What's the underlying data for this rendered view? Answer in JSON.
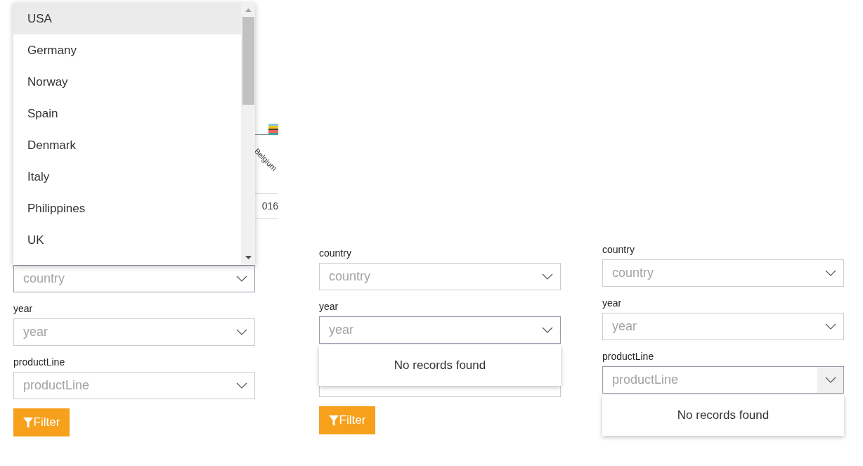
{
  "background_chart": {
    "x_label": "Belgium",
    "year_cell": "016"
  },
  "panels": [
    {
      "fields": [
        {
          "placeholder": "country",
          "focused": true,
          "hovered": false,
          "popup": {
            "kind": "list",
            "options": [
              {
                "label": "USA",
                "highlighted": true
              },
              {
                "label": "Germany",
                "highlighted": false
              },
              {
                "label": "Norway",
                "highlighted": false
              },
              {
                "label": "Spain",
                "highlighted": false
              },
              {
                "label": "Denmark",
                "highlighted": false
              },
              {
                "label": "Italy",
                "highlighted": false
              },
              {
                "label": "Philippines",
                "highlighted": false
              },
              {
                "label": "UK",
                "highlighted": false
              }
            ]
          }
        },
        {
          "label": "year",
          "placeholder": "year",
          "focused": false,
          "hovered": false
        },
        {
          "label": "productLine",
          "placeholder": "productLine",
          "focused": false,
          "hovered": false
        }
      ],
      "button": "Filter"
    },
    {
      "fields": [
        {
          "label": "country",
          "placeholder": "country",
          "focused": false,
          "hovered": false
        },
        {
          "label": "year",
          "placeholder": "year",
          "focused": true,
          "hovered": false,
          "popup": {
            "kind": "message",
            "message": "No records found"
          }
        },
        {
          "focused": false,
          "hovered": false
        }
      ],
      "button": "Filter"
    },
    {
      "fields": [
        {
          "label": "country",
          "placeholder": "country",
          "focused": false,
          "hovered": false
        },
        {
          "label": "year",
          "placeholder": "year",
          "focused": false,
          "hovered": false
        },
        {
          "label": "productLine",
          "placeholder": "productLine",
          "focused": true,
          "hovered": true,
          "popup": {
            "kind": "message",
            "message": "No records found"
          }
        }
      ]
    }
  ]
}
